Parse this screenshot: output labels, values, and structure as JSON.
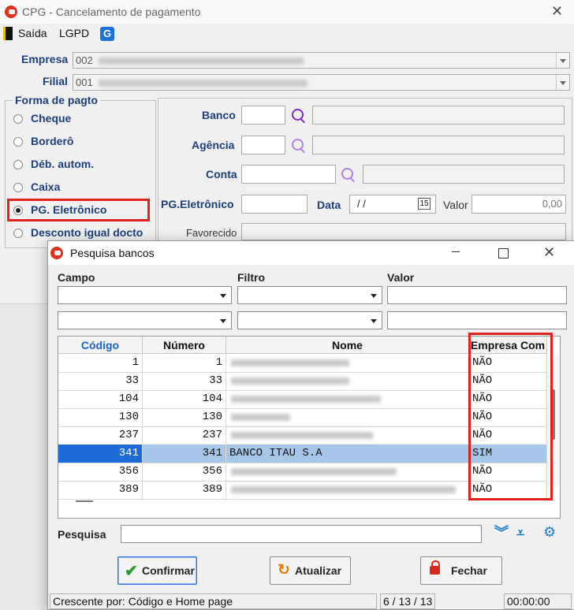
{
  "window": {
    "title": "CPG - Cancelamento de pagamento"
  },
  "menu": {
    "exit": "Saída",
    "lgpd": "LGPD"
  },
  "form": {
    "empresa_label": "Empresa",
    "empresa_value": "002",
    "filial_label": "Filial",
    "filial_value": "001",
    "group_title": "Forma de pagto",
    "options": [
      "Cheque",
      "Borderô",
      "Déb. autom.",
      "Caixa",
      "PG. Eletrônico",
      "Desconto igual docto"
    ],
    "banco_label": "Banco",
    "agencia_label": "Agência",
    "conta_label": "Conta",
    "pg_label": "PG.Eletrônico",
    "data_label": "Data",
    "data_value": "/ /",
    "cal_icon_text": "15",
    "valor_label": "Valor",
    "valor_value": "0,00",
    "favorecido_label": "Favorecido"
  },
  "dialog": {
    "title": "Pesquisa bancos",
    "campo_label": "Campo",
    "filtro_label": "Filtro",
    "valor_label": "Valor",
    "columns": [
      "Código",
      "Número",
      "Nome",
      "Empresa Com"
    ],
    "rows": [
      {
        "codigo": "1",
        "numero": "1",
        "nome": "",
        "empresa": "NÃO"
      },
      {
        "codigo": "33",
        "numero": "33",
        "nome": "",
        "empresa": "NÃO"
      },
      {
        "codigo": "104",
        "numero": "104",
        "nome": "",
        "empresa": "NÃO"
      },
      {
        "codigo": "130",
        "numero": "130",
        "nome": "",
        "empresa": "NÃO"
      },
      {
        "codigo": "237",
        "numero": "237",
        "nome": "",
        "empresa": "NÃO"
      },
      {
        "codigo": "341",
        "numero": "341",
        "nome": "BANCO ITAU S.A",
        "empresa": "SIM"
      },
      {
        "codigo": "356",
        "numero": "356",
        "nome": "",
        "empresa": "NÃO"
      },
      {
        "codigo": "389",
        "numero": "389",
        "nome": "",
        "empresa": "NÃO"
      }
    ],
    "search_label": "Pesquisa",
    "confirm": "Confirmar",
    "refresh": "Atualizar",
    "close": "Fechar",
    "status_sort": "Crescente por: Código e Home page",
    "status_pos": "6 / 13 / 13",
    "status_time": "00:00:00"
  }
}
